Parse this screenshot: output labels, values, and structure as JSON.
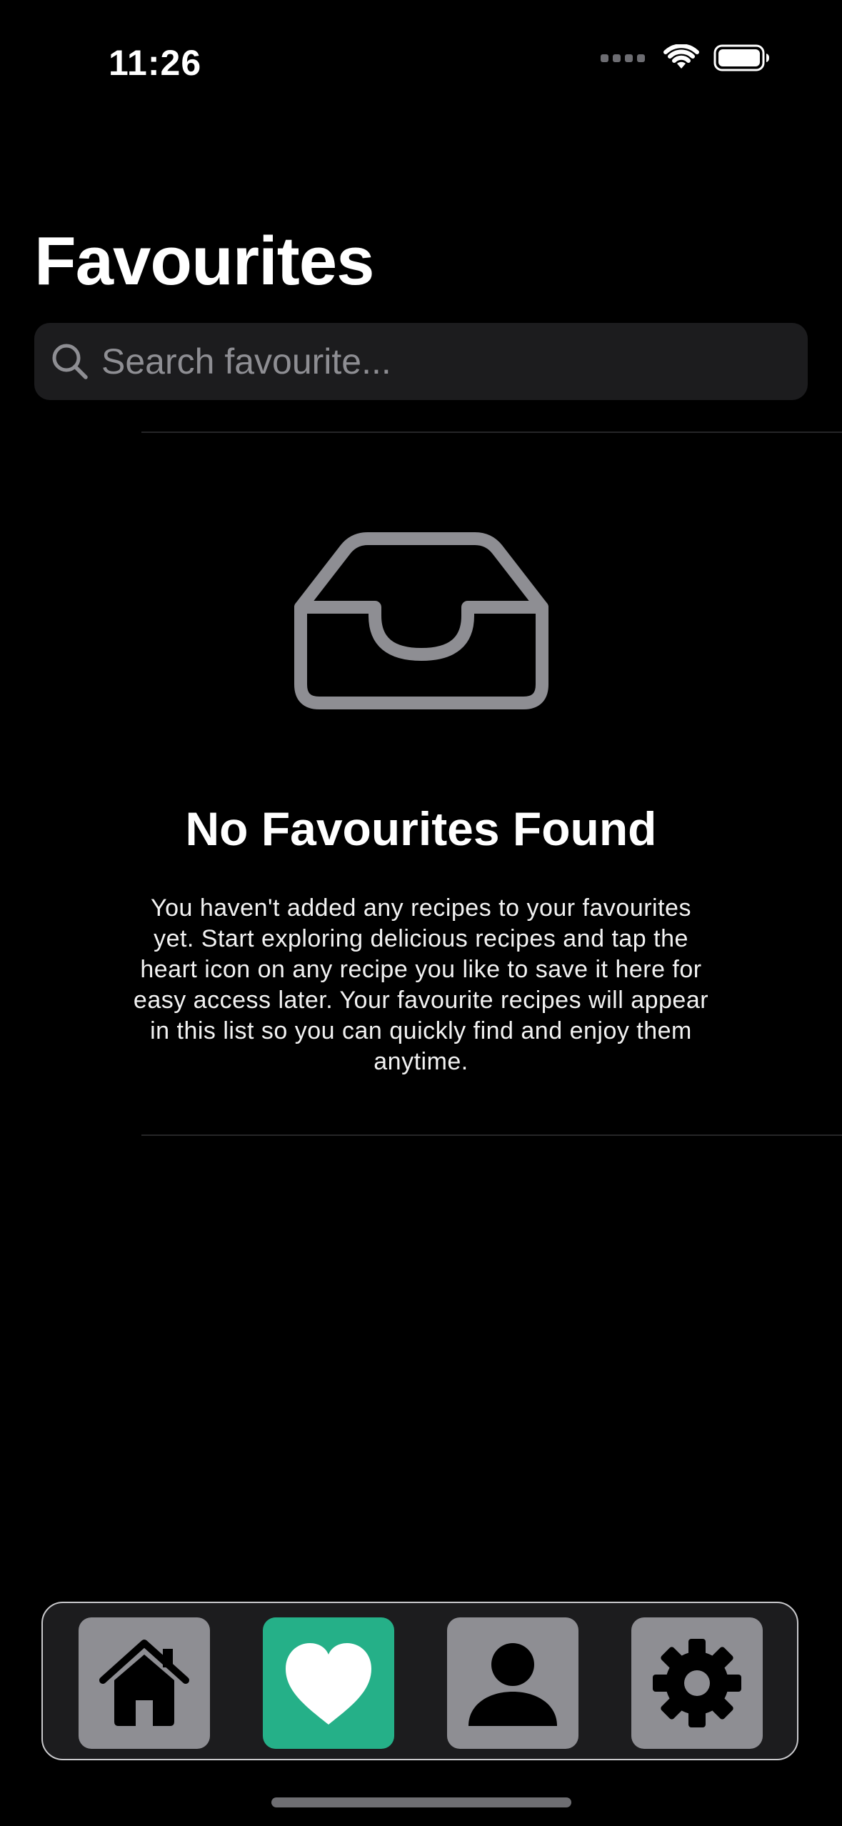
{
  "status_bar": {
    "time": "11:26"
  },
  "header": {
    "title": "Favourites"
  },
  "search": {
    "placeholder": "Search favourite...",
    "value": ""
  },
  "empty_state": {
    "icon": "tray-icon",
    "title": "No Favourites Found",
    "message": "You haven't added any recipes to your favourites yet. Start exploring delicious recipes and tap the heart icon on any recipe you like to save it here for easy access later. Your favourite recipes will appear in this list so you can quickly find and enjoy them anytime."
  },
  "tab_bar": {
    "items": [
      {
        "icon": "home-icon",
        "active": false
      },
      {
        "icon": "heart-icon",
        "active": true
      },
      {
        "icon": "person-icon",
        "active": false
      },
      {
        "icon": "gear-icon",
        "active": false
      }
    ]
  },
  "colors": {
    "background": "#000000",
    "surface": "#1c1c1e",
    "accent": "#25b088",
    "inactive_tab": "#8e8e93",
    "muted_icon": "#8e8e93"
  }
}
